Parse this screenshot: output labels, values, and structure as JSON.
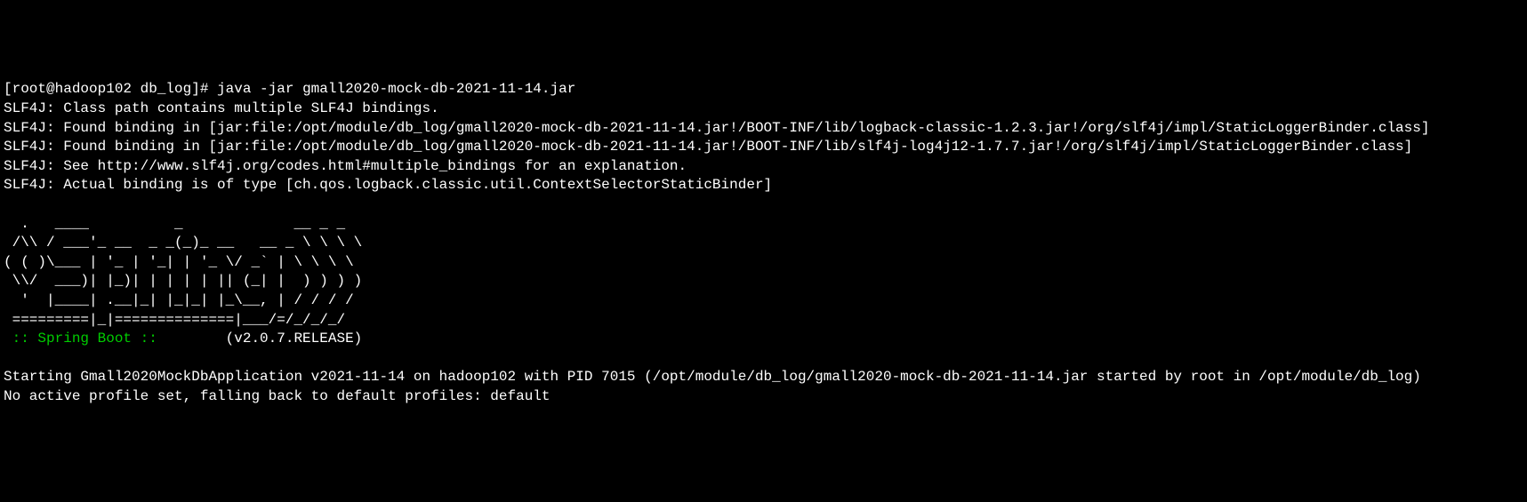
{
  "terminal": {
    "prompt": "[root@hadoop102 db_log]# ",
    "command": "java -jar gmall2020-mock-db-2021-11-14.jar",
    "lines": {
      "l1": "SLF4J: Class path contains multiple SLF4J bindings.",
      "l2": "SLF4J: Found binding in [jar:file:/opt/module/db_log/gmall2020-mock-db-2021-11-14.jar!/BOOT-INF/lib/logback-classic-1.2.3.jar!/org/slf4j/impl/StaticLoggerBinder.class]",
      "l3": "SLF4J: Found binding in [jar:file:/opt/module/db_log/gmall2020-mock-db-2021-11-14.jar!/BOOT-INF/lib/slf4j-log4j12-1.7.7.jar!/org/slf4j/impl/StaticLoggerBinder.class]",
      "l4": "SLF4J: See http://www.slf4j.org/codes.html#multiple_bindings for an explanation.",
      "l5": "SLF4J: Actual binding is of type [ch.qos.logback.classic.util.ContextSelectorStaticBinder]"
    },
    "ascii": {
      "a1": "  .   ____          _             __ _ _",
      "a2": " /\\\\ / ___'_ __  _ _(_)_ __   __ _ \\ \\ \\ \\",
      "a3": "( ( )\\___ | '_ | '_| | '_ \\/ _` | \\ \\ \\ \\",
      "a4": " \\\\/  ___)| |_)| | | | | || (_| |  ) ) ) )",
      "a5": "  '  |____| .__|_| |_|_| |_\\__, | / / / /",
      "a6": " =========|_|==============|___/=/_/_/_/"
    },
    "spring_label": " :: Spring Boot ::",
    "spring_version": "        (v2.0.7.RELEASE)",
    "footer": {
      "f1": "Starting Gmall2020MockDbApplication v2021-11-14 on hadoop102 with PID 7015 (/opt/module/db_log/gmall2020-mock-db-2021-11-14.jar started by root in /opt/module/db_log)",
      "f2": "No active profile set, falling back to default profiles: default"
    }
  }
}
